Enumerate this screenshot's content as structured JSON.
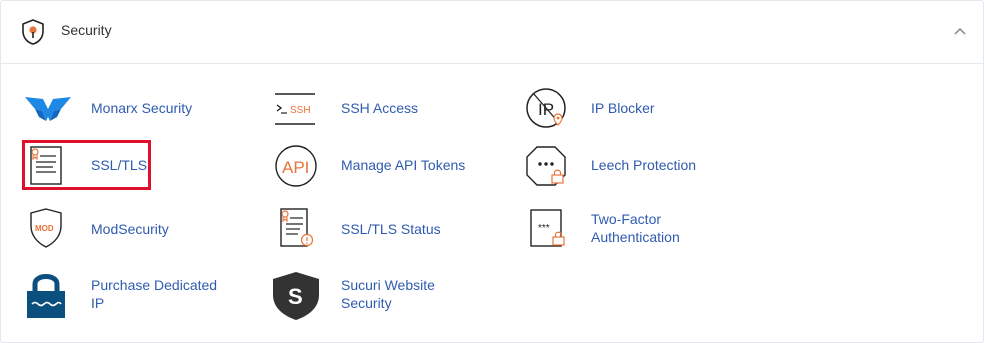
{
  "section": {
    "title": "Security",
    "header_icon": "shield-lock-icon",
    "toggle_icon": "chevron-up-icon"
  },
  "tools": [
    {
      "label": "Monarx Security",
      "icon": "monarx-butterfly-icon"
    },
    {
      "label": "SSH Access",
      "icon": "ssh-terminal-icon",
      "icon_text": "SSH"
    },
    {
      "label": "IP Blocker",
      "icon": "ip-blocker-icon",
      "icon_text": "IP"
    },
    {
      "label": "SSL/TLS",
      "icon": "ssl-certificate-icon"
    },
    {
      "label": "Manage API Tokens",
      "icon": "api-tokens-icon",
      "icon_text": "API"
    },
    {
      "label": "Leech Protection",
      "icon": "leech-protection-icon"
    },
    {
      "label": "ModSecurity",
      "icon": "modsecurity-shield-icon",
      "icon_text": "MOD"
    },
    {
      "label": "SSL/TLS Status",
      "icon": "ssl-status-icon"
    },
    {
      "label": "Two-Factor Authentication",
      "icon": "two-factor-icon"
    },
    {
      "label": "Purchase Dedicated IP",
      "icon": "dedicated-ip-lock-icon"
    },
    {
      "label": "Sucuri Website Security",
      "icon": "sucuri-shield-icon",
      "icon_text": "S"
    }
  ],
  "colors": {
    "link": "#2f5bb0",
    "accent_orange": "#e8743b",
    "highlight_border": "#e0102d",
    "icon_dark": "#222222",
    "monarx_blue": "#1e88e5",
    "dedicated_ip_blue": "#0a4f7d"
  }
}
